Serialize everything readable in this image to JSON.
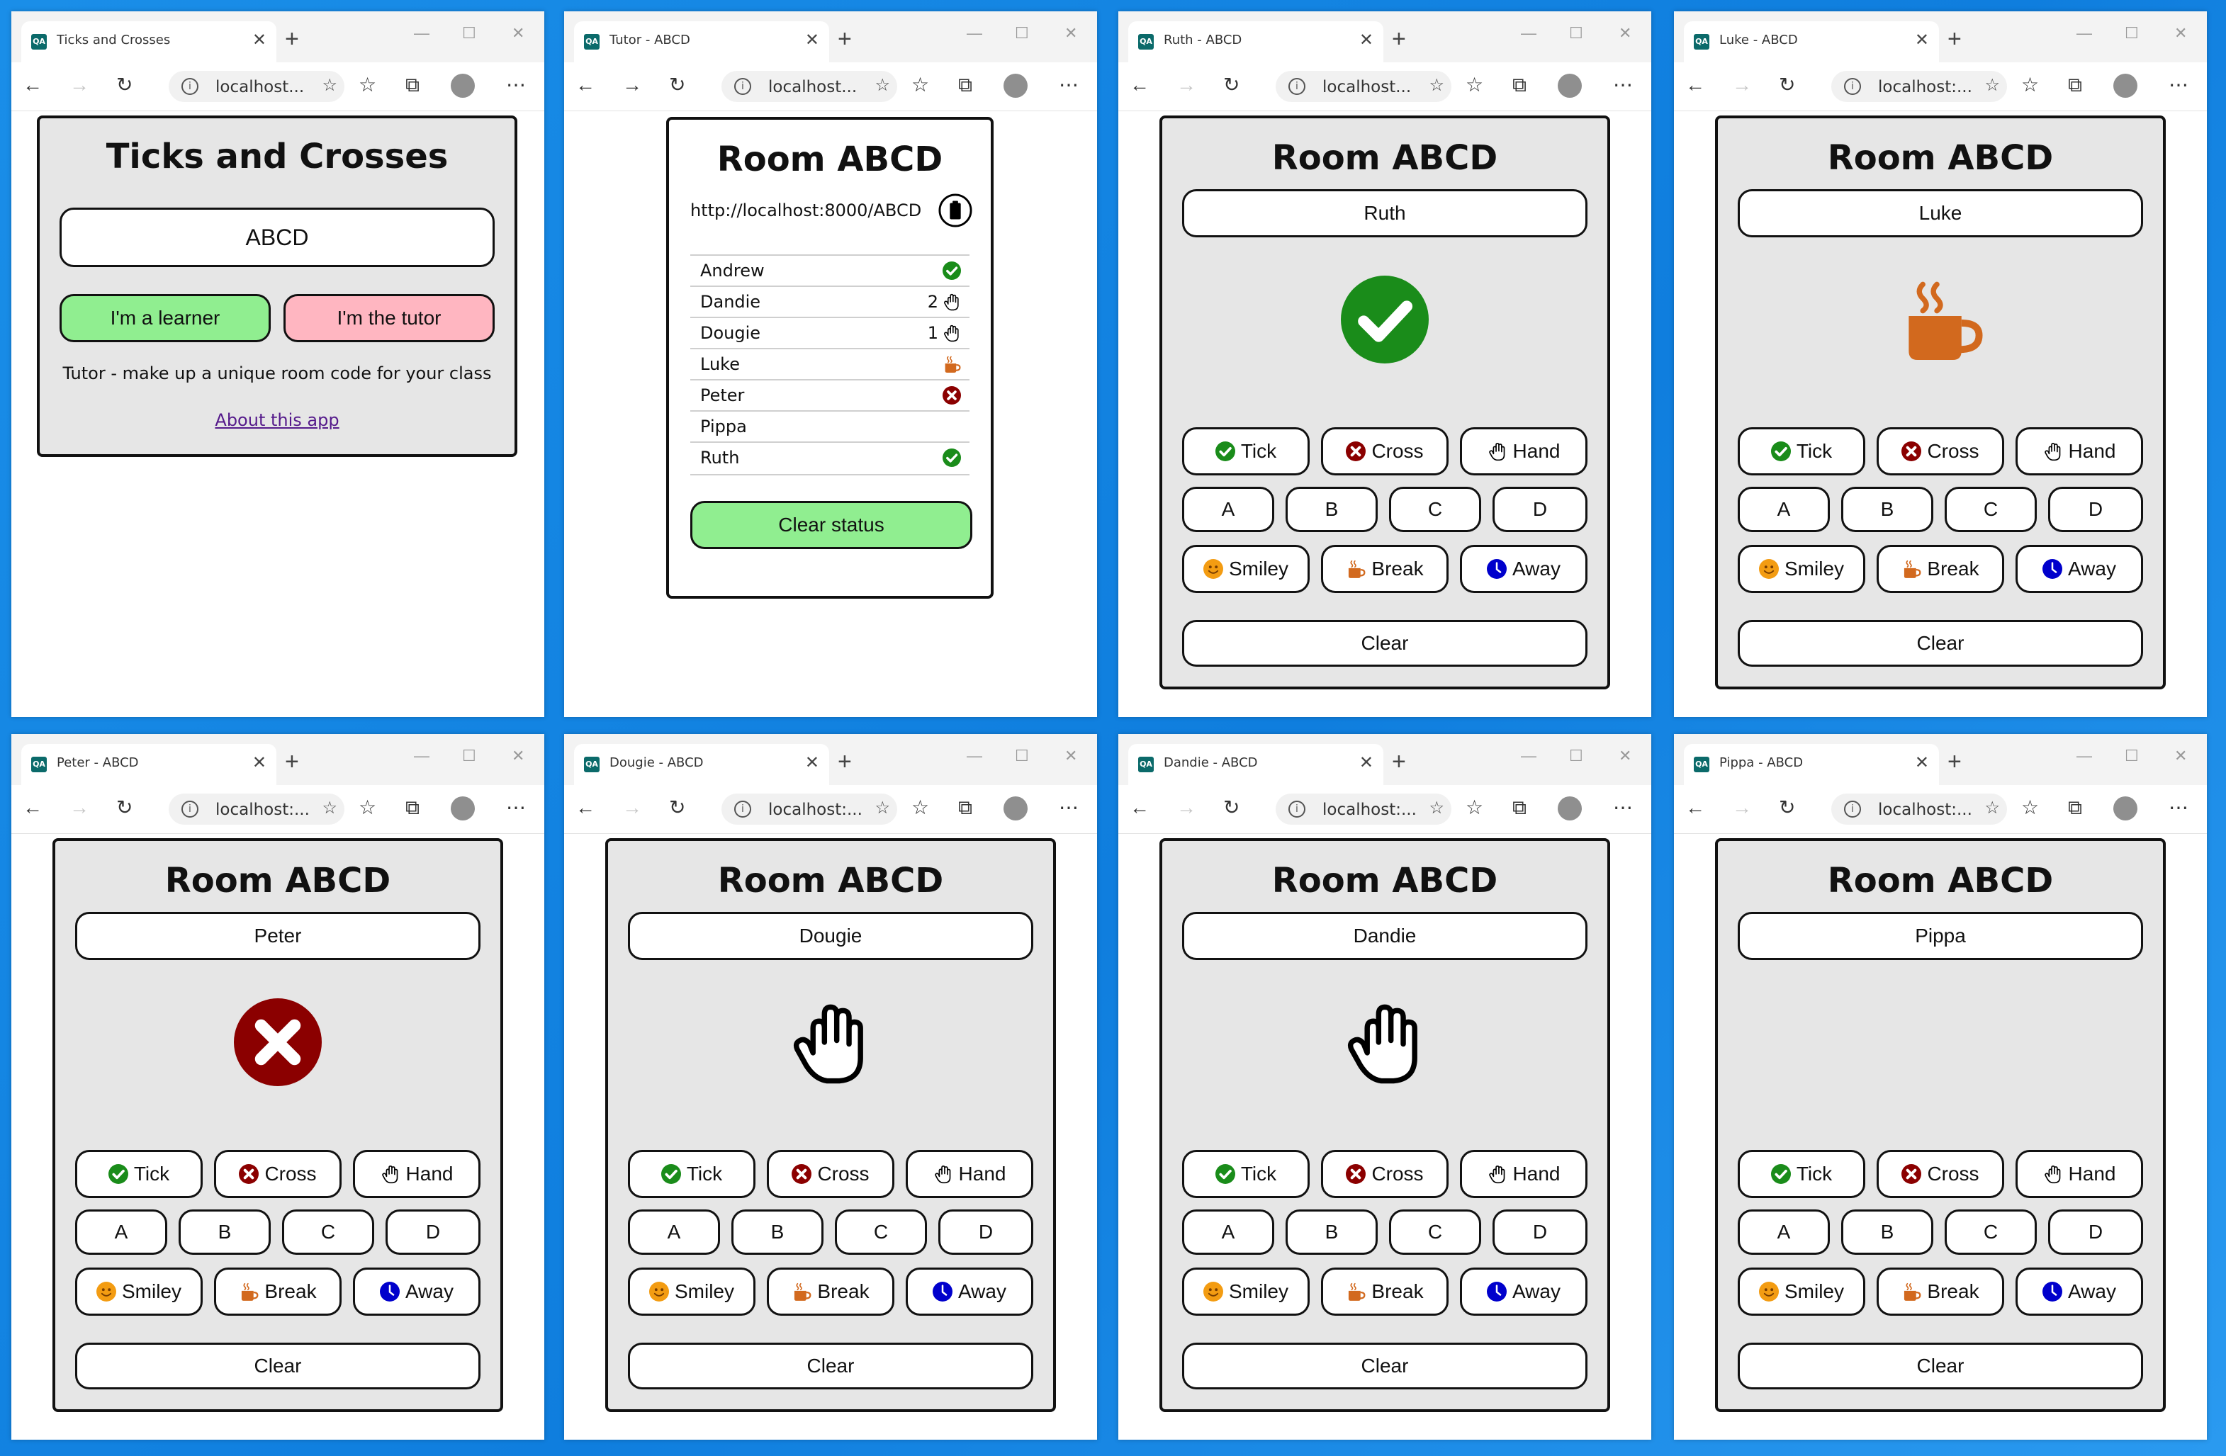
{
  "windows": [
    {
      "tab_title": "Ticks and Crosses",
      "url": "localhost..."
    },
    {
      "tab_title": "Tutor - ABCD",
      "url": "localhost..."
    },
    {
      "tab_title": "Ruth - ABCD",
      "url": "localhost..."
    },
    {
      "tab_title": "Luke - ABCD",
      "url": "localhost:..."
    },
    {
      "tab_title": "Peter - ABCD",
      "url": "localhost:..."
    },
    {
      "tab_title": "Dougie - ABCD",
      "url": "localhost:..."
    },
    {
      "tab_title": "Dandie - ABCD",
      "url": "localhost:..."
    },
    {
      "tab_title": "Pippa - ABCD",
      "url": "localhost:..."
    }
  ],
  "home": {
    "title": "Ticks and Crosses",
    "room_code": "ABCD",
    "learner_label": "I'm a learner",
    "tutor_label": "I'm the tutor",
    "hint": "Tutor - make up a unique room code for your class",
    "about_label": "About this app"
  },
  "tutor": {
    "title": "Room ABCD",
    "url": "http://localhost:8000/ABCD",
    "copy_icon": "clipboard-icon",
    "students": [
      {
        "name": "Andrew",
        "count": "",
        "status": "tick"
      },
      {
        "name": "Dandie",
        "count": "2",
        "status": "hand"
      },
      {
        "name": "Dougie",
        "count": "1",
        "status": "hand"
      },
      {
        "name": "Luke",
        "count": "",
        "status": "break"
      },
      {
        "name": "Peter",
        "count": "",
        "status": "cross"
      },
      {
        "name": "Pippa",
        "count": "",
        "status": ""
      },
      {
        "name": "Ruth",
        "count": "",
        "status": "tick"
      }
    ],
    "clear_status_label": "Clear status"
  },
  "learner_common": {
    "room_title": "Room ABCD",
    "tick": "Tick",
    "cross": "Cross",
    "hand": "Hand",
    "a": "A",
    "b": "B",
    "c": "C",
    "d": "D",
    "smiley": "Smiley",
    "break": "Break",
    "away": "Away",
    "clear": "Clear"
  },
  "learners": [
    {
      "name": "Ruth",
      "status": "tick"
    },
    {
      "name": "Luke",
      "status": "break"
    },
    {
      "name": "Peter",
      "status": "cross"
    },
    {
      "name": "Dougie",
      "status": "hand"
    },
    {
      "name": "Dandie",
      "status": "hand"
    },
    {
      "name": "Pippa",
      "status": ""
    }
  ],
  "colors": {
    "tick": "#1a8c1a",
    "cross": "#8b0000",
    "break": "#d2691e",
    "smiley": "#f39c12",
    "away": "#0000cc",
    "learner_button": "#90ee90",
    "tutor_button": "#ffb6c1",
    "card_bg": "#e6e6e6",
    "desktop": "#0f7ede"
  }
}
